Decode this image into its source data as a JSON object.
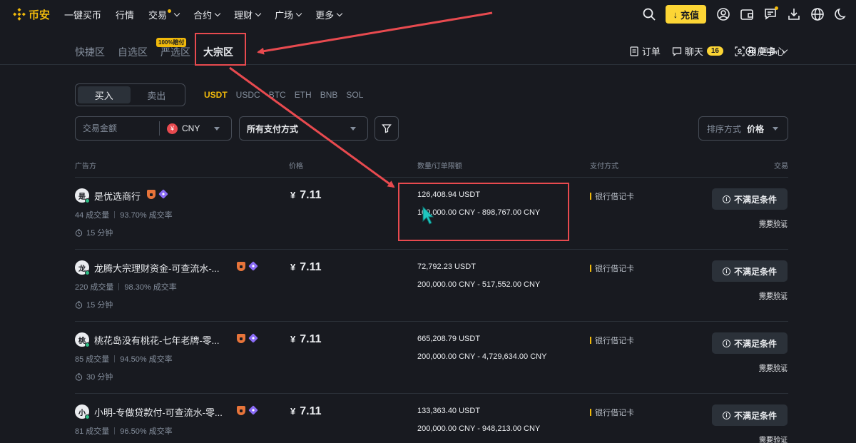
{
  "header": {
    "brand": "币安",
    "nav": [
      {
        "label": "一键买币",
        "caret": false
      },
      {
        "label": "行情",
        "caret": false
      },
      {
        "label": "交易",
        "caret": true,
        "dot": true
      },
      {
        "label": "合约",
        "caret": true
      },
      {
        "label": "理财",
        "caret": true
      },
      {
        "label": "广场",
        "caret": true
      },
      {
        "label": "更多",
        "caret": true
      }
    ],
    "deposit_label": "充值",
    "icons": [
      "search-icon",
      "user-icon",
      "wallet-icon",
      "message-icon",
      "download-icon",
      "globe-icon",
      "moon-icon"
    ]
  },
  "subnav": {
    "tabs": [
      "快捷区",
      "自选区",
      "严选区",
      "大宗区"
    ],
    "active_tab": "大宗区",
    "promo_badge": "100%赔付",
    "links": {
      "orders": "订单",
      "chat": "聊天",
      "chat_count": "16",
      "user_center": "用户中心",
      "more": "更多"
    }
  },
  "filters": {
    "buy_label": "买入",
    "sell_label": "卖出",
    "coins": [
      "USDT",
      "USDC",
      "BTC",
      "ETH",
      "BNB",
      "SOL"
    ],
    "active_coin": "USDT",
    "amount_placeholder": "交易金额",
    "fiat": "CNY",
    "fiat_symbol": "¥",
    "payment_method": "所有支付方式",
    "sort_label": "排序方式",
    "sort_value": "价格"
  },
  "table": {
    "headers": {
      "advertiser": "广告方",
      "price": "价格",
      "limit": "数量/订单限额",
      "payment": "支付方式",
      "trade": "交易"
    },
    "rows": [
      {
        "avatar": "是",
        "name": "是优选商行",
        "trades": "44 成交量",
        "rate": "93.70% 成交率",
        "time": "15 分钟",
        "currency": "¥",
        "price": "7.11",
        "quantity": "126,408.94 USDT",
        "limit": "100,000.00 CNY - 898,767.00 CNY",
        "payment": "银行借记卡",
        "action": "不满足条件",
        "verify": "需要验证"
      },
      {
        "avatar": "龙",
        "name": "龙腾大宗理财资金-可查流水-...",
        "trades": "220 成交量",
        "rate": "98.30% 成交率",
        "time": "15 分钟",
        "currency": "¥",
        "price": "7.11",
        "quantity": "72,792.23 USDT",
        "limit": "200,000.00 CNY - 517,552.00 CNY",
        "payment": "银行借记卡",
        "action": "不满足条件",
        "verify": "需要验证"
      },
      {
        "avatar": "桃",
        "name": "桃花岛没有桃花-七年老牌-零...",
        "trades": "85 成交量",
        "rate": "94.50% 成交率",
        "time": "30 分钟",
        "currency": "¥",
        "price": "7.11",
        "quantity": "665,208.79 USDT",
        "limit": "200,000.00 CNY - 4,729,634.00 CNY",
        "payment": "银行借记卡",
        "action": "不满足条件",
        "verify": "需要验证"
      },
      {
        "avatar": "小",
        "name": "小明-专做贷款付-可查流水-零...",
        "trades": "81 成交量",
        "rate": "96.50% 成交率",
        "time": "",
        "currency": "¥",
        "price": "7.11",
        "quantity": "133,363.40 USDT",
        "limit": "200,000.00 CNY - 948,213.00 CNY",
        "payment": "银行借记卡",
        "action": "不满足条件",
        "verify": "需要验证"
      }
    ]
  },
  "colors": {
    "accent": "#f0b90b",
    "annotation": "#e84a4f",
    "cursor": "#1fc7c0",
    "background": "#181a20"
  }
}
